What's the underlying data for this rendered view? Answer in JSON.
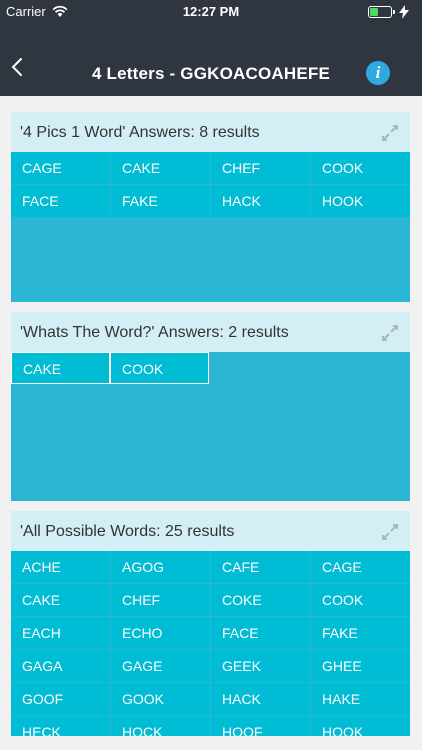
{
  "status": {
    "carrier": "Carrier",
    "time": "12:27 PM",
    "battery_color": "#4cd964"
  },
  "nav": {
    "title": "4 Letters - GGKOACOAHEFE",
    "back_icon": "chevron-left-icon",
    "info_icon": "info-icon",
    "info_glyph": "i",
    "bar_color": "#2f3640",
    "info_color": "#30a8e0"
  },
  "colors": {
    "cell": "#00bcd4",
    "section_bg": "#2bb6d6",
    "header_bg": "#d3eff5"
  },
  "sections": [
    {
      "title": "'4 Pics 1 Word' Answers: 8 results",
      "words": [
        "CAGE",
        "CAKE",
        "CHEF",
        "COOK",
        "FACE",
        "FAKE",
        "HACK",
        "HOOK"
      ]
    },
    {
      "title": "'Whats The Word?' Answers: 2 results",
      "words": [
        "CAKE",
        "COOK"
      ]
    },
    {
      "title": "'All Possible Words: 25 results",
      "words": [
        "ACHE",
        "AGOG",
        "CAFE",
        "CAGE",
        "CAKE",
        "CHEF",
        "COKE",
        "COOK",
        "EACH",
        "ECHO",
        "FACE",
        "FAKE",
        "GAGA",
        "GAGE",
        "GEEK",
        "GHEE",
        "GOOF",
        "GOOK",
        "HACK",
        "HAKE",
        "HECK",
        "HOCK",
        "HOOF",
        "HOOK"
      ]
    }
  ]
}
